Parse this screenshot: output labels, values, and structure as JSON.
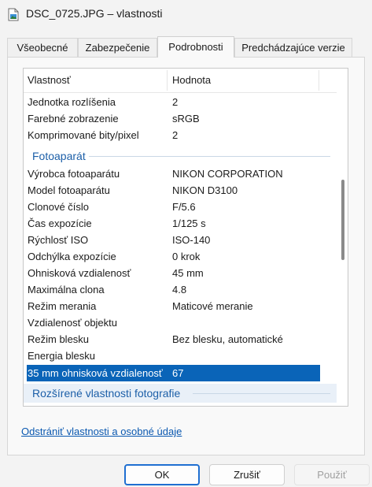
{
  "window": {
    "title": "DSC_0725.JPG – vlastnosti"
  },
  "tabs": [
    {
      "label": "Všeobecné"
    },
    {
      "label": "Zabezpečenie"
    },
    {
      "label": "Podrobnosti"
    },
    {
      "label": "Predchádzajúce verzie"
    }
  ],
  "active_tab": "Podrobnosti",
  "list": {
    "headers": {
      "property": "Vlastnosť",
      "value": "Hodnota"
    },
    "rows_image": [
      {
        "name": "Jednotka rozlíšenia",
        "value": "2"
      },
      {
        "name": "Farebné zobrazenie",
        "value": "sRGB"
      },
      {
        "name": "Komprimované bity/pixel",
        "value": "2"
      }
    ],
    "group_camera": "Fotoaparát",
    "rows_camera": [
      {
        "name": "Výrobca fotoaparátu",
        "value": "NIKON CORPORATION"
      },
      {
        "name": "Model fotoaparátu",
        "value": "NIKON D3100"
      },
      {
        "name": "Clonové číslo",
        "value": "F/5.6"
      },
      {
        "name": "Čas expozície",
        "value": "1/125 s"
      },
      {
        "name": "Rýchlosť ISO",
        "value": "ISO-140"
      },
      {
        "name": "Odchýlka expozície",
        "value": "0 krok"
      },
      {
        "name": "Ohnisková vzdialenosť",
        "value": "45 mm"
      },
      {
        "name": "Maximálna clona",
        "value": "4.8"
      },
      {
        "name": "Režim merania",
        "value": "Maticové meranie"
      },
      {
        "name": "Vzdialenosť objektu",
        "value": ""
      },
      {
        "name": "Režim blesku",
        "value": "Bez blesku, automatické"
      },
      {
        "name": "Energia blesku",
        "value": ""
      },
      {
        "name": "35 mm ohnisková vzdialenosť",
        "value": "67"
      }
    ],
    "selected_row": "35 mm ohnisková vzdialenosť",
    "group_advanced": "Rozšírené vlastnosti fotografie"
  },
  "remove_link": "Odstrániť vlastnosti a osobné údaje",
  "buttons": {
    "ok": "OK",
    "cancel": "Zrušiť",
    "apply": "Použiť"
  }
}
